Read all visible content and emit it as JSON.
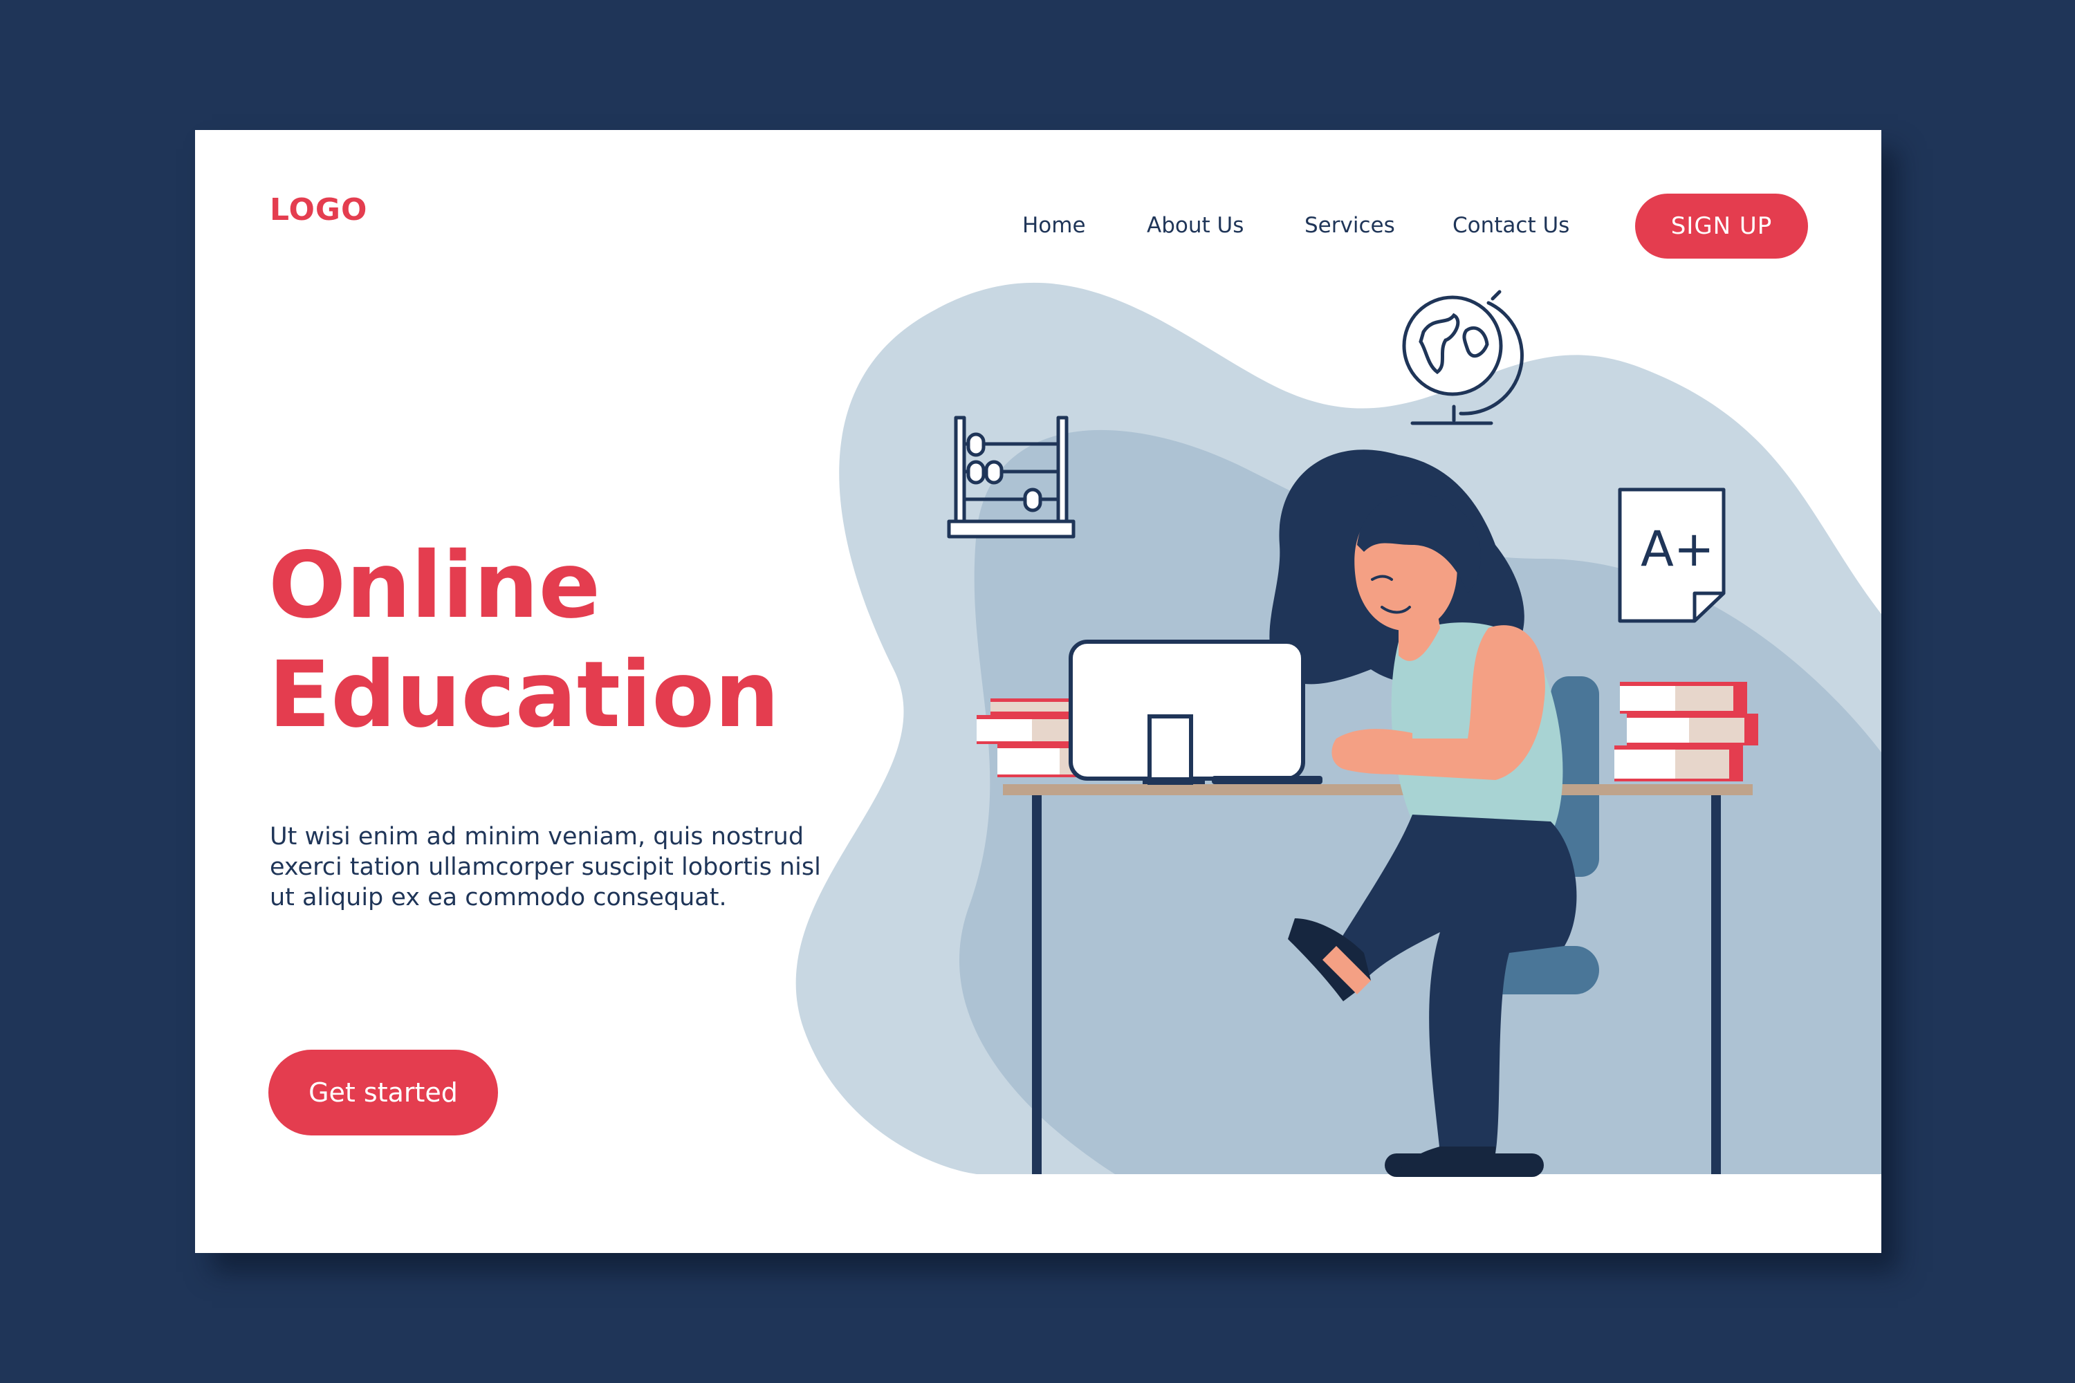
{
  "header": {
    "logo": "LOGO",
    "nav": [
      {
        "label": "Home"
      },
      {
        "label": "About Us"
      },
      {
        "label": "Services"
      },
      {
        "label": "Contact Us"
      }
    ],
    "signup_label": "SIGN UP"
  },
  "hero": {
    "title_line1": "Online",
    "title_line2": "Education",
    "body": "Ut wisi enim ad minim veniam, quis nostrud exerci tation ullamcorper suscipit lobortis nisl ut aliquip ex ea commodo consequat.",
    "cta_label": "Get started"
  },
  "illustration": {
    "grade_badge": "A+",
    "icons": [
      "abacus-icon",
      "globe-icon",
      "grade-paper-icon"
    ]
  },
  "colors": {
    "background": "#1f3558",
    "accent": "#e43d4f",
    "text": "#1f3558",
    "blob_light": "#c8d7e2",
    "blob_mid": "#adc2d3"
  }
}
